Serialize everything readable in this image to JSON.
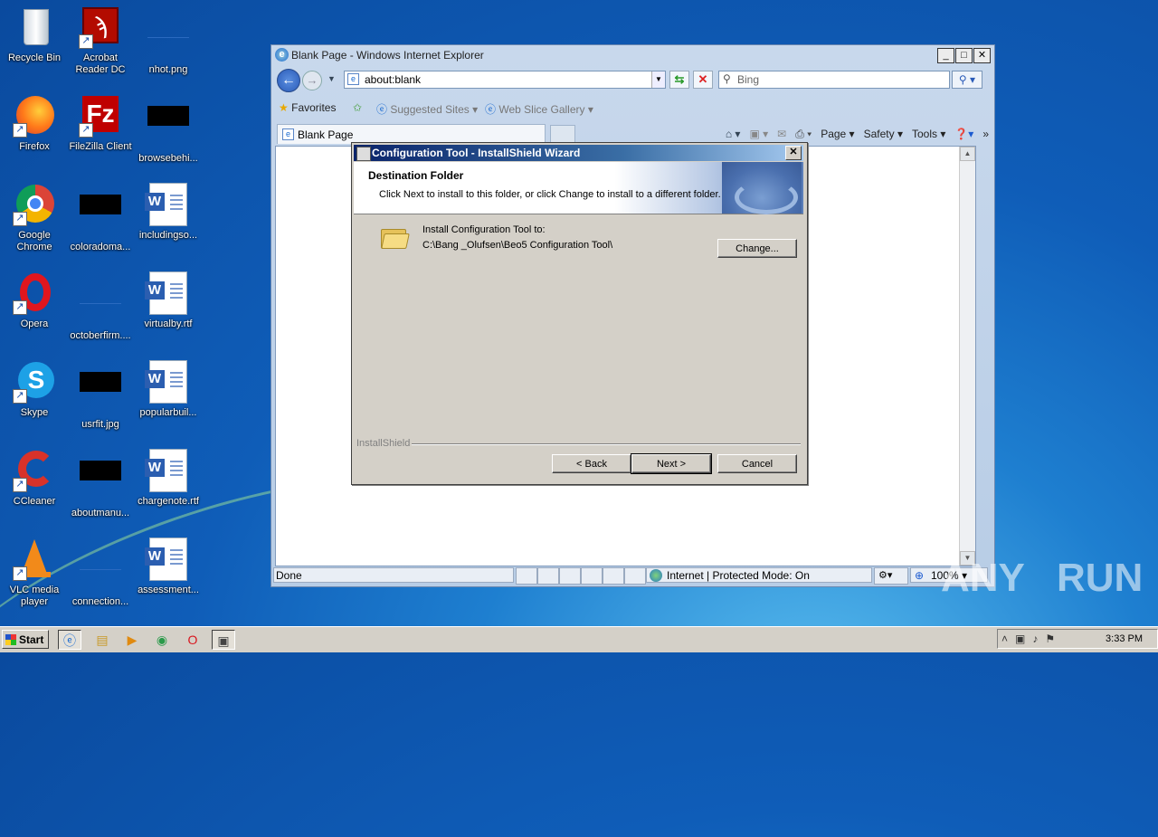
{
  "desktop": {
    "icons": [
      {
        "id": "recycle",
        "label": "Recycle Bin"
      },
      {
        "id": "acrobat",
        "label": "Acrobat Reader DC"
      },
      {
        "id": "nhot",
        "label": "nhot.png"
      },
      {
        "id": "firefox",
        "label": "Firefox"
      },
      {
        "id": "filezilla",
        "label": "FileZilla Client"
      },
      {
        "id": "browse",
        "label": "browsebehi..."
      },
      {
        "id": "chrome",
        "label": "Google Chrome"
      },
      {
        "id": "colorado",
        "label": "coloradoma..."
      },
      {
        "id": "includingso",
        "label": "includingso..."
      },
      {
        "id": "opera",
        "label": "Opera"
      },
      {
        "id": "october",
        "label": "octoberfirm...."
      },
      {
        "id": "virtualby",
        "label": "virtualby.rtf"
      },
      {
        "id": "skype",
        "label": "Skype"
      },
      {
        "id": "usrfit",
        "label": "usrfit.jpg"
      },
      {
        "id": "popularbuil",
        "label": "popularbuil..."
      },
      {
        "id": "ccleaner",
        "label": "CCleaner"
      },
      {
        "id": "aboutmanu",
        "label": "aboutmanu..."
      },
      {
        "id": "chargenote",
        "label": "chargenote.rtf"
      },
      {
        "id": "vlc",
        "label": "VLC media player"
      },
      {
        "id": "connection",
        "label": "connection..."
      },
      {
        "id": "assessment",
        "label": "assessment..."
      }
    ]
  },
  "ie": {
    "title": "Blank Page - Windows Internet Explorer",
    "address": "about:blank",
    "search_placeholder": "Bing",
    "favorites_label": "Favorites",
    "suggested_sites": "Suggested Sites",
    "web_slice_gallery": "Web Slice Gallery",
    "tab_label": "Blank Page",
    "cmd": {
      "page": "Page",
      "safety": "Safety",
      "tools": "Tools"
    },
    "status": "Done",
    "zone": "Internet | Protected Mode: On",
    "zoom": "100%"
  },
  "dialog": {
    "title": "Configuration Tool - InstallShield Wizard",
    "heading": "Destination Folder",
    "subheading": "Click Next to install to this folder, or click Change to install to a different folder.",
    "install_label": "Install Configuration Tool to:",
    "install_path": "C:\\Bang _Olufsen\\Beo5 Configuration Tool\\",
    "change_button": "Change...",
    "brand": "InstallShield",
    "back_button": "< Back",
    "next_button": "Next >",
    "cancel_button": "Cancel"
  },
  "taskbar": {
    "start_label": "Start",
    "clock": "3:33 PM"
  },
  "watermark": {
    "text_left": "ANY",
    "text_right": "RUN"
  },
  "colors": {
    "desktop": "#0f5db8",
    "dialog_title": "#0a246a",
    "dialog_bg": "#d4d0c8"
  }
}
